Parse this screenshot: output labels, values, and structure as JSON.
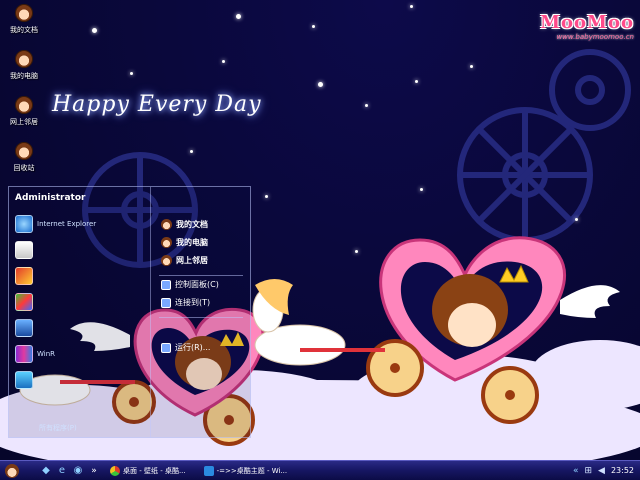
{
  "desktop": {
    "icons": [
      {
        "label": "我的文档"
      },
      {
        "label": "我的电脑"
      },
      {
        "label": "网上邻居"
      },
      {
        "label": "回收站"
      }
    ],
    "greeting": "Happy Every Day",
    "brand": {
      "logo": "MooMoo",
      "url": "www.babymoomoo.cn"
    }
  },
  "start_menu": {
    "user": "Administrator",
    "pinned": [
      {
        "title": "Internet Explorer",
        "icon": "ie-icon"
      },
      {
        "title": "",
        "icon": "ftp-icon"
      },
      {
        "title": "",
        "icon": "book-icon"
      },
      {
        "title": "",
        "icon": "paint-icon"
      },
      {
        "title": "",
        "icon": "monitor-icon"
      },
      {
        "title": "WinR",
        "icon": "winrar-icon"
      },
      {
        "title": "",
        "icon": "player-icon"
      }
    ],
    "all_programs": "所有程序(P)",
    "right_items": [
      {
        "label": "我的文档",
        "bold": true
      },
      {
        "label": "我的电脑",
        "bold": true
      },
      {
        "label": "网上邻居",
        "bold": true
      },
      {
        "label": "控制面板(C)",
        "bold": false
      },
      {
        "label": "连接到(T)",
        "bold": false
      },
      {
        "label": "运行(R)...",
        "bold": false
      }
    ]
  },
  "taskbar": {
    "tasks": [
      {
        "label": "桌面 - 壁纸 - 桌酷..."
      },
      {
        "label": "-=>>桌酷主题 - Wi..."
      }
    ],
    "clock": "23:52"
  },
  "colors": {
    "sky": "#0a083c",
    "heart": "#ff7fb6",
    "taskbar": "#161662"
  }
}
